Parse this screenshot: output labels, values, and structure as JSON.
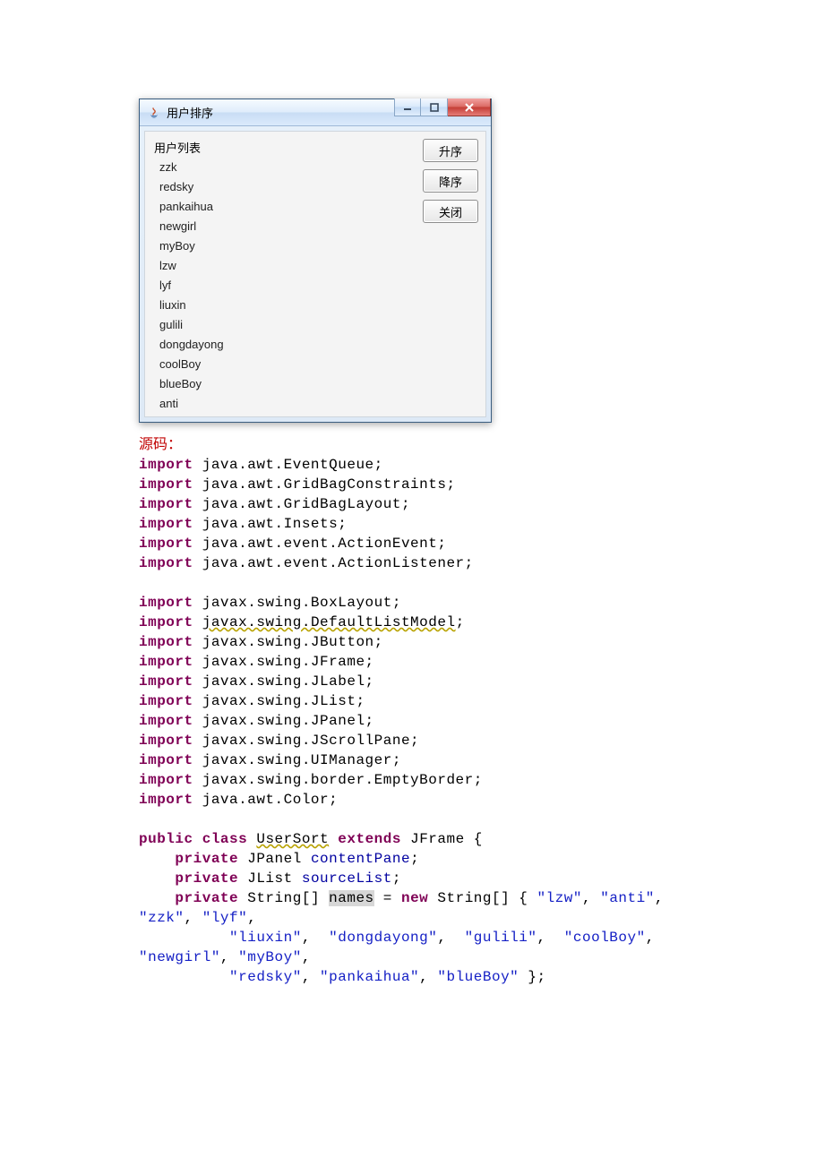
{
  "window": {
    "title": "用户排序",
    "list_label": "用户列表",
    "items": [
      "zzk",
      "redsky",
      "pankaihua",
      "newgirl",
      "myBoy",
      "lzw",
      "lyf",
      "liuxin",
      "gulili",
      "dongdayong",
      "coolBoy",
      "blueBoy",
      "anti"
    ],
    "buttons": {
      "asc": "升序",
      "desc": "降序",
      "close": "关闭"
    }
  },
  "source_heading": "源码",
  "code": {
    "import_kw": "import",
    "public_kw": "public",
    "class_kw": "class",
    "extends_kw": "extends",
    "private_kw": "private",
    "new_kw": "new",
    "imports_block1": [
      "java.awt.EventQueue;",
      "java.awt.GridBagConstraints;",
      "java.awt.GridBagLayout;",
      "java.awt.Insets;",
      "java.awt.event.ActionEvent;",
      "java.awt.event.ActionListener;"
    ],
    "imports_block2_first_prefix": "javax.swing.BoxLayout;",
    "imports_block2_warn": "javax.swing.DefaultListModel",
    "imports_block2_rest": [
      "javax.swing.JButton;",
      "javax.swing.JFrame;",
      "javax.swing.JLabel;",
      "javax.swing.JList;",
      "javax.swing.JPanel;",
      "javax.swing.JScrollPane;",
      "javax.swing.UIManager;",
      "javax.swing.border.EmptyBorder;",
      "java.awt.Color;"
    ],
    "class_name": "UserSort",
    "superclass": "JFrame",
    "field1_type": "JPanel",
    "field1_name": "contentPane",
    "field2_type": "JList",
    "field2_name": "sourceList",
    "field3_type": "String[]",
    "field3_name": "names",
    "arr_type": "String[]",
    "strings_line1": [
      "\"lzw\"",
      "\"anti\""
    ],
    "strings_line2": [
      "\"zzk\"",
      "\"lyf\""
    ],
    "strings_line3": [
      "\"liuxin\"",
      "\"dongdayong\"",
      "\"gulili\"",
      "\"coolBoy\""
    ],
    "strings_line4": [
      "\"newgirl\"",
      "\"myBoy\""
    ],
    "strings_line5": [
      "\"redsky\"",
      "\"pankaihua\"",
      "\"blueBoy\""
    ]
  }
}
